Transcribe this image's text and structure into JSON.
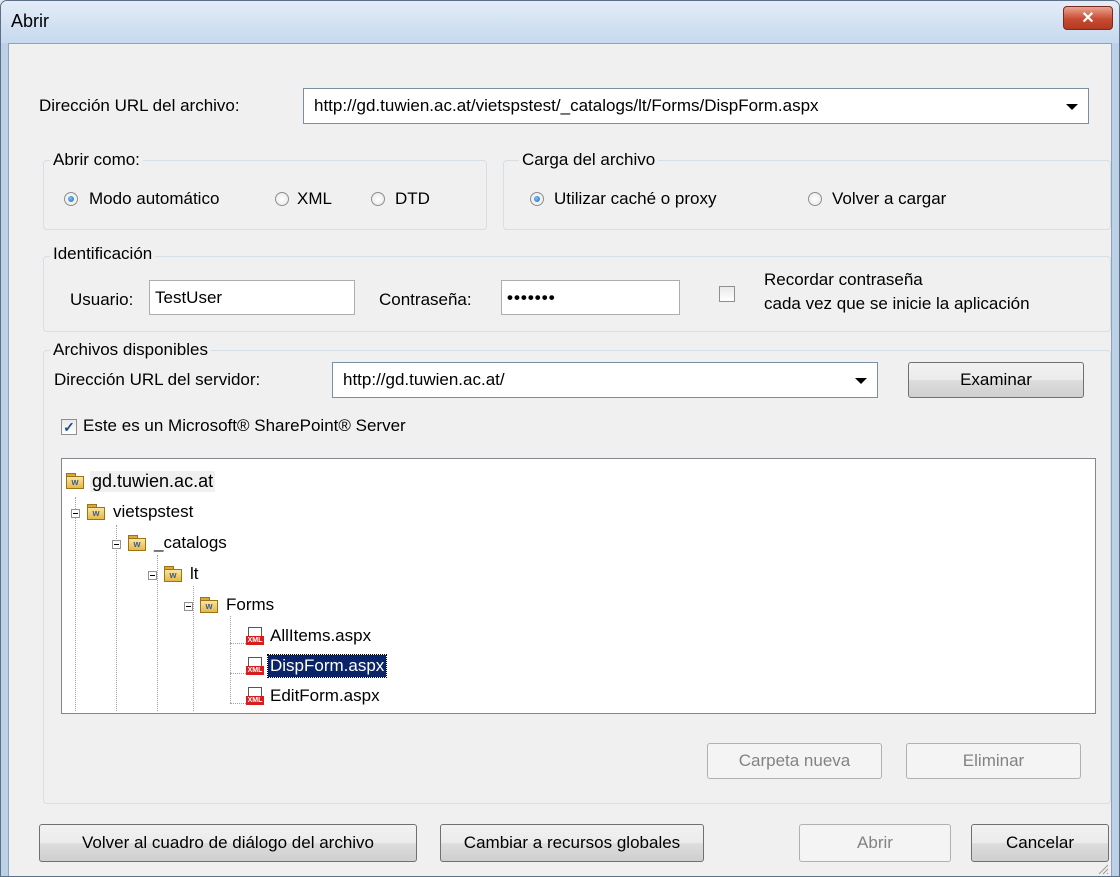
{
  "window": {
    "title": "Abrir",
    "close_label": "✕"
  },
  "file_url": {
    "label": "Dirección URL del archivo:",
    "value": "http://gd.tuwien.ac.at/vietspstest/_catalogs/lt/Forms/DispForm.aspx"
  },
  "open_as": {
    "title": "Abrir como:",
    "options": [
      "Modo automático",
      "XML",
      "DTD"
    ],
    "selected": "Modo automático"
  },
  "file_load": {
    "title": "Carga del archivo",
    "options": [
      "Utilizar caché o proxy",
      "Volver a cargar"
    ],
    "selected": "Utilizar caché o proxy"
  },
  "identification": {
    "title": "Identificación",
    "user_label": "Usuario:",
    "user_value": "TestUser",
    "password_label": "Contraseña:",
    "password_value": "•••••••",
    "remember_line1": "Recordar contraseña",
    "remember_line2": "cada vez que se inicie la aplicación",
    "remember_checked": false
  },
  "available_files": {
    "title": "Archivos disponibles",
    "server_url_label": "Dirección URL del servidor:",
    "server_url_value": "http://gd.tuwien.ac.at/",
    "browse_label": "Examinar",
    "sharepoint_label": "Este es un Microsoft® SharePoint® Server",
    "sharepoint_checked": true,
    "tree": {
      "root": "gd.tuwien.ac.at",
      "site": "vietspstest",
      "catalogs": "_catalogs",
      "lt": "lt",
      "forms": "Forms",
      "files": [
        "AllItems.aspx",
        "DispForm.aspx",
        "EditForm.aspx"
      ],
      "selected_file": "DispForm.aspx",
      "folder_icon_letter": "w",
      "file_icon_label": "XML"
    },
    "new_folder_label": "Carpeta nueva",
    "delete_label": "Eliminar"
  },
  "footer": {
    "back_label": "Volver al cuadro de diálogo del archivo",
    "global_label": "Cambiar a recursos globales",
    "open_label": "Abrir",
    "cancel_label": "Cancelar"
  },
  "colors": {
    "selection": "#0a246a",
    "close_button": "#c84a31",
    "title_bar": "#c6d9ee"
  }
}
